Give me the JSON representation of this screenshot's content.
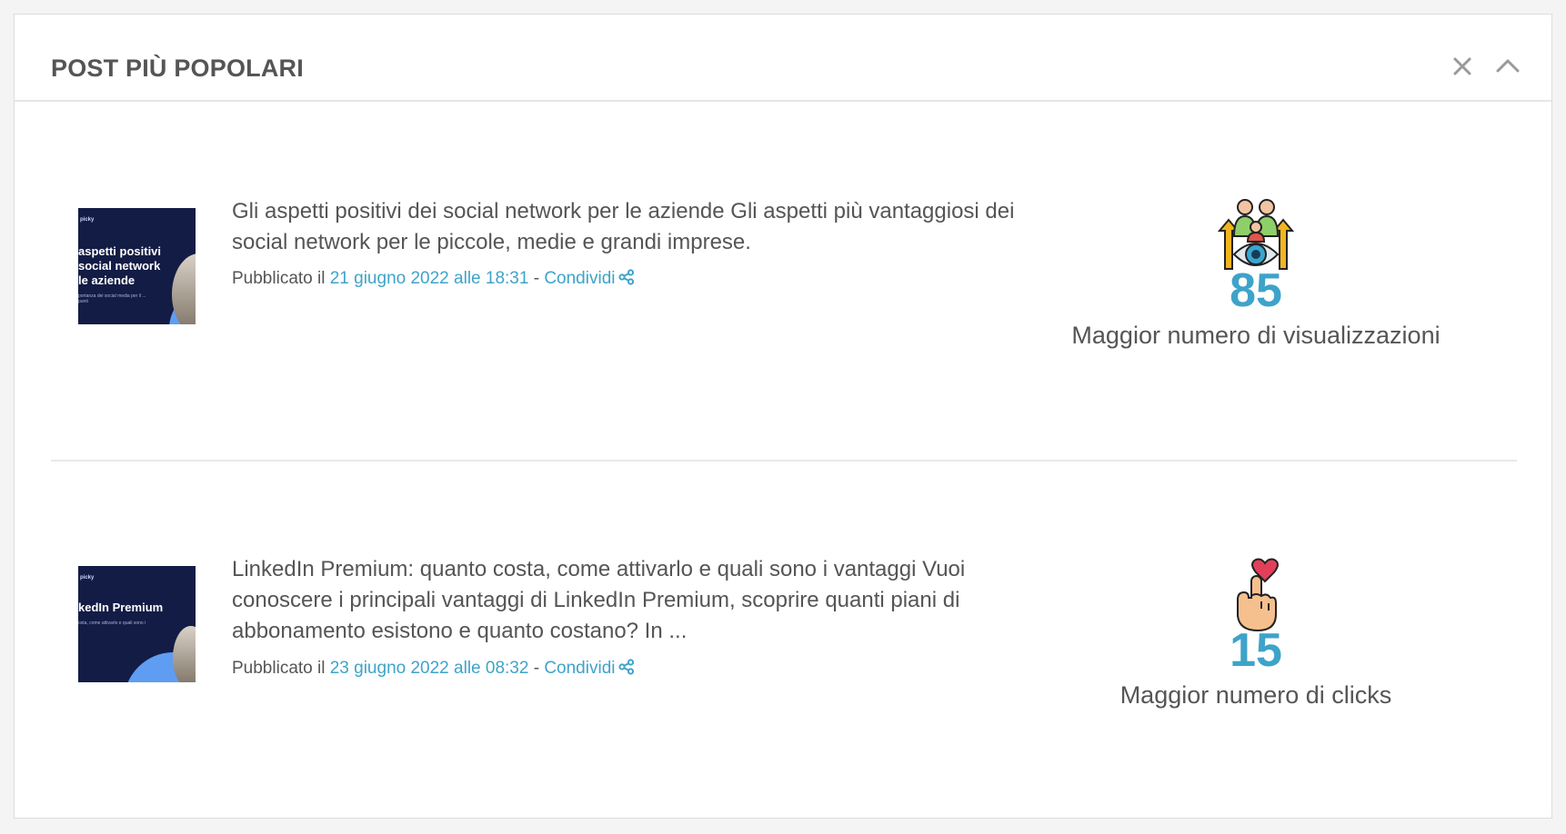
{
  "panel": {
    "title": "POST PIÙ POPOLARI"
  },
  "posts": [
    {
      "thumbnail": {
        "brand": "picky",
        "lines": [
          "aspetti positivi",
          "social network",
          "le aziende"
        ],
        "sub": "portanza dei social media per il ... punti"
      },
      "text": "Gli aspetti positivi dei social network per le aziende Gli aspetti più vantaggiosi dei social network per le piccole, medie e grandi imprese.",
      "published_prefix": "Pubblicato il",
      "date": "21 giugno 2022 alle 18:31",
      "separator": "-",
      "share_label": "Condividi",
      "stat": {
        "icon": "audience-eye-icon",
        "value": "85",
        "label": "Maggior numero di visualizzazioni"
      }
    },
    {
      "thumbnail": {
        "brand": "picky",
        "lines": [
          "kedIn Premium"
        ],
        "sub": "osta, come attivarlo e quali sono i"
      },
      "text": "LinkedIn Premium: quanto costa, come attivarlo e quali sono i vantaggi Vuoi conoscere i principali vantaggi di LinkedIn Premium, scoprire quanti piani di abbonamento esistono e quanto costano? In ...",
      "published_prefix": "Pubblicato il",
      "date": "23 giugno 2022 alle 08:32",
      "separator": "-",
      "share_label": "Condividi",
      "stat": {
        "icon": "hand-click-heart-icon",
        "value": "15",
        "label": "Maggior numero di clicks"
      }
    }
  ],
  "colors": {
    "accent": "#3ea3c9",
    "thumb_bg": "#131c45",
    "thumb_circle": "#5f9df2"
  }
}
